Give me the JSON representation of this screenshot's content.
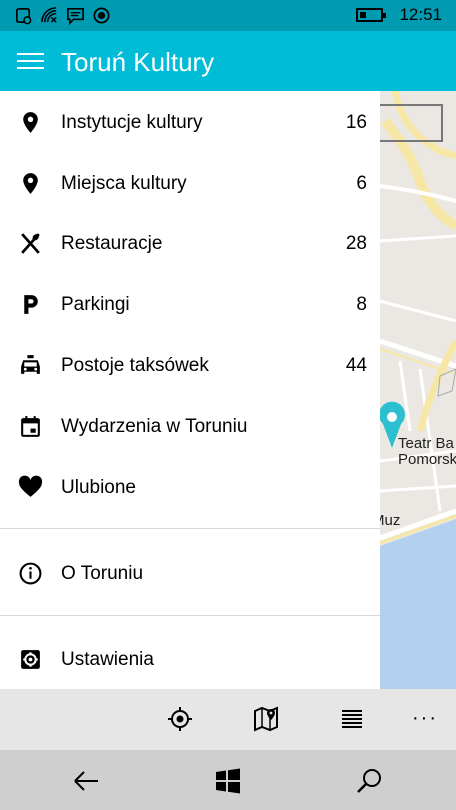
{
  "status_bar": {
    "time": "12:51",
    "icons": [
      "notification-icon",
      "wifi-calling-icon",
      "message-icon",
      "location-on-icon"
    ]
  },
  "header": {
    "title": "Toruń Kultury"
  },
  "menu": {
    "items": [
      {
        "label": "Instytucje kultury",
        "count": "16",
        "icon": "map-pin-icon"
      },
      {
        "label": "Miejsca kultury",
        "count": "6",
        "icon": "map-pin-icon"
      },
      {
        "label": "Restauracje",
        "count": "28",
        "icon": "fork-spoon-icon"
      },
      {
        "label": "Parkingi",
        "count": "8",
        "icon": "parking-icon"
      },
      {
        "label": "Postoje taksówek",
        "count": "44",
        "icon": "taxi-icon"
      },
      {
        "label": "Wydarzenia w Toruniu",
        "icon": "calendar-icon"
      },
      {
        "label": "Ulubione",
        "icon": "heart-icon"
      }
    ],
    "about": {
      "label": "O Toruniu",
      "icon": "info-icon"
    },
    "settings": {
      "label": "Ustawienia",
      "icon": "settings-icon"
    }
  },
  "map": {
    "labels": {
      "poi_line1": "Teatr Ba",
      "poi_line2": "Pomorsk",
      "muz": "Muz"
    },
    "colors": {
      "land": "#ebe8e3",
      "water": "#b3d0ee",
      "road": "#f7e7a6",
      "poi": "#2bbfcf"
    }
  },
  "app_bar": {
    "buttons": [
      "locate-icon",
      "map-icon",
      "list-icon"
    ],
    "more": "···"
  },
  "nav_bar": {
    "buttons": [
      "back-arrow-icon",
      "windows-icon",
      "search-icon"
    ]
  },
  "colors": {
    "status_bar": "#009ab1",
    "header": "#00bcd6",
    "app_bar": "#e6e6e6",
    "nav_bar": "#cfcfcf"
  }
}
